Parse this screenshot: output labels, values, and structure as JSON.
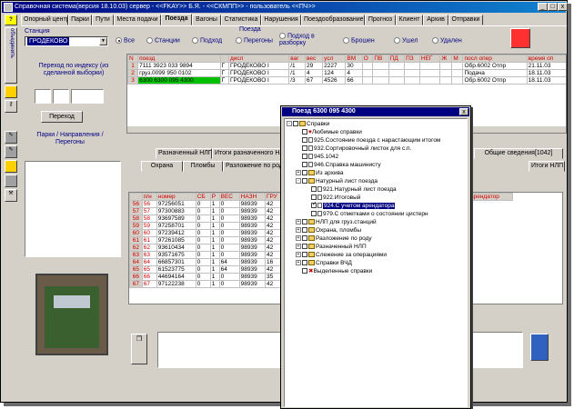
{
  "window": {
    "title": "Справочная система(версия 18.10.03) сервер - <<FKAY>> Б.Я. - <<СКМПП>> - пользователь <<ПЧ>>"
  },
  "leftbar": {
    "vertical_label": "объединить",
    "question": "?"
  },
  "tabs": [
    "Опорный центр",
    "Парки",
    "Пути",
    "Места подачи",
    "Поезда",
    "Вагоны",
    "Статистика",
    "Нарушения",
    "Поездообразование",
    "Прогноз",
    "Клиент",
    "Архив",
    "Отправки"
  ],
  "station": {
    "label": "Станция",
    "value": "ГРОДЕКОВО"
  },
  "trains_group": {
    "label": "Поезда"
  },
  "radios": [
    {
      "label": "Все",
      "checked": true
    },
    {
      "label": "Станции",
      "checked": false
    },
    {
      "label": "Подход",
      "checked": false
    },
    {
      "label": "Перегоны",
      "checked": false
    },
    {
      "label": "Подход в разборку",
      "checked": false
    },
    {
      "label": "Брошен",
      "checked": false
    },
    {
      "label": "Ушел",
      "checked": false
    },
    {
      "label": "Удален",
      "checked": false
    }
  ],
  "index_search": {
    "label": "Переход по индексу (из сделанной выборки)",
    "button": "Переход"
  },
  "parks_label": "Парки / Направления / Перегоны",
  "train_table": {
    "headers": [
      "N",
      "поезд",
      "",
      "дисл",
      "ваг",
      "вес",
      "усл",
      "ВМ",
      "О",
      "ПВ",
      "ПД",
      "ПЗ",
      "НЕГ",
      "Ж",
      "М",
      "посл опер",
      "время оп"
    ],
    "rows": [
      [
        "1",
        "7111 3923 033 9894",
        "Г",
        "ГРОДЕКОВО I",
        "/1",
        "29",
        "2227",
        "30",
        "",
        "",
        "",
        "",
        "",
        "",
        "",
        "Обр.6002 Отпр",
        "21.11.03"
      ],
      [
        "2",
        "груз.0099 950 0102",
        "Г",
        "ГРОДЕКОВО I",
        "/1",
        "4",
        "124",
        "4",
        "",
        "",
        "",
        "",
        "",
        "",
        "",
        "Подача",
        "18.11.03"
      ],
      [
        "3",
        "6300 6300 095 4300",
        "Г",
        "ГРОДЕКОВО I",
        "/3",
        "67",
        "4526",
        "66",
        "",
        "",
        "",
        "",
        "",
        "",
        "",
        "Обр.6002 Отпр",
        "18.11.03"
      ]
    ]
  },
  "sub_tabs_row1": [
    "Разначенный НЛП",
    "Итоги разначенного НЛП",
    "Общие сведения[1042]"
  ],
  "sub_tabs_row2": [
    "Охрана",
    "Пломбы",
    "Разложение по роду",
    "Итоги НЛП"
  ],
  "wagon_table": {
    "headers": [
      "п/н",
      "номер",
      "СБ",
      "Р",
      "ВЕС",
      "НАЗН",
      "ГРУ"
    ],
    "extra_header": "арендатор",
    "rows": [
      [
        "56",
        "56",
        "97256051",
        "0",
        "1",
        "0",
        "98939",
        "42"
      ],
      [
        "57",
        "57",
        "97300883",
        "0",
        "1",
        "0",
        "98939",
        "42"
      ],
      [
        "58",
        "58",
        "93697589",
        "0",
        "1",
        "0",
        "98939",
        "42"
      ],
      [
        "59",
        "59",
        "97258701",
        "0",
        "1",
        "0",
        "98939",
        "42"
      ],
      [
        "60",
        "60",
        "97239412",
        "0",
        "1",
        "0",
        "98939",
        "42"
      ],
      [
        "61",
        "61",
        "97261085",
        "0",
        "1",
        "0",
        "98939",
        "42"
      ],
      [
        "62",
        "62",
        "93610434",
        "0",
        "1",
        "0",
        "98939",
        "42"
      ],
      [
        "63",
        "63",
        "93571675",
        "0",
        "1",
        "0",
        "98939",
        "42"
      ],
      [
        "64",
        "64",
        "66857301",
        "0",
        "1",
        "64",
        "98939",
        "16"
      ],
      [
        "65",
        "65",
        "61523775",
        "0",
        "1",
        "64",
        "98939",
        "42"
      ],
      [
        "66",
        "66",
        "44694164",
        "0",
        "1",
        "0",
        "98939",
        "35"
      ],
      [
        "67",
        "67",
        "97122238",
        "0",
        "1",
        "0",
        "98939",
        "42"
      ]
    ]
  },
  "dialog": {
    "title": "Поезд 6300 095 4300",
    "close": "x",
    "tree": [
      {
        "label": "Справки",
        "level": 0,
        "type": "folder",
        "exp": "-",
        "checked": false
      },
      {
        "label": "Любимые справки",
        "level": 1,
        "type": "star",
        "exp": "",
        "checked": false
      },
      {
        "label": "925.Состояние поезда с нарастающим итогом",
        "level": 1,
        "type": "doc",
        "exp": "",
        "checked": false
      },
      {
        "label": "932.Сортировочный листок для с.п.",
        "level": 1,
        "type": "doc",
        "exp": "",
        "checked": false
      },
      {
        "label": "945.1042",
        "level": 1,
        "type": "doc",
        "exp": "",
        "checked": false
      },
      {
        "label": "946.Справка машинисту",
        "level": 1,
        "type": "doc",
        "exp": "",
        "checked": false
      },
      {
        "label": "Из архива",
        "level": 1,
        "type": "folder",
        "exp": "+",
        "checked": false
      },
      {
        "label": "Натурный лист поезда",
        "level": 1,
        "type": "folder",
        "exp": "-",
        "checked": false
      },
      {
        "label": "921.Натурный лист поезда",
        "level": 2,
        "type": "doc",
        "exp": "",
        "checked": false
      },
      {
        "label": "922.Итоговый",
        "level": 2,
        "type": "doc",
        "exp": "",
        "checked": false
      },
      {
        "label": "924.С учетом арендатора",
        "level": 2,
        "type": "doc",
        "exp": "",
        "checked": true,
        "highlight": true
      },
      {
        "label": "979.С отметками о состоянии цистерн",
        "level": 2,
        "type": "doc",
        "exp": "",
        "checked": false
      },
      {
        "label": "НЛП для груз.станций",
        "level": 1,
        "type": "folder",
        "exp": "+",
        "checked": false
      },
      {
        "label": "Охрана, пломбы",
        "level": 1,
        "type": "folder",
        "exp": "+",
        "checked": false
      },
      {
        "label": "Разложение по роду",
        "level": 1,
        "type": "folder",
        "exp": "+",
        "checked": false
      },
      {
        "label": "Разначенный НЛП",
        "level": 1,
        "type": "folder",
        "exp": "+",
        "checked": false
      },
      {
        "label": "Слежение за операциями",
        "level": 1,
        "type": "folder",
        "exp": "+",
        "checked": false
      },
      {
        "label": "Справки ВЧД",
        "level": 1,
        "type": "folder",
        "exp": "+",
        "checked": false
      },
      {
        "label": "Выделенные справки",
        "level": 1,
        "type": "cross",
        "exp": "",
        "checked": false
      }
    ]
  },
  "colors": {
    "window_bg": "#d4d0c8",
    "title_bg": "#000080",
    "highlight_row": "#00c000",
    "num_text": "#c00000"
  }
}
